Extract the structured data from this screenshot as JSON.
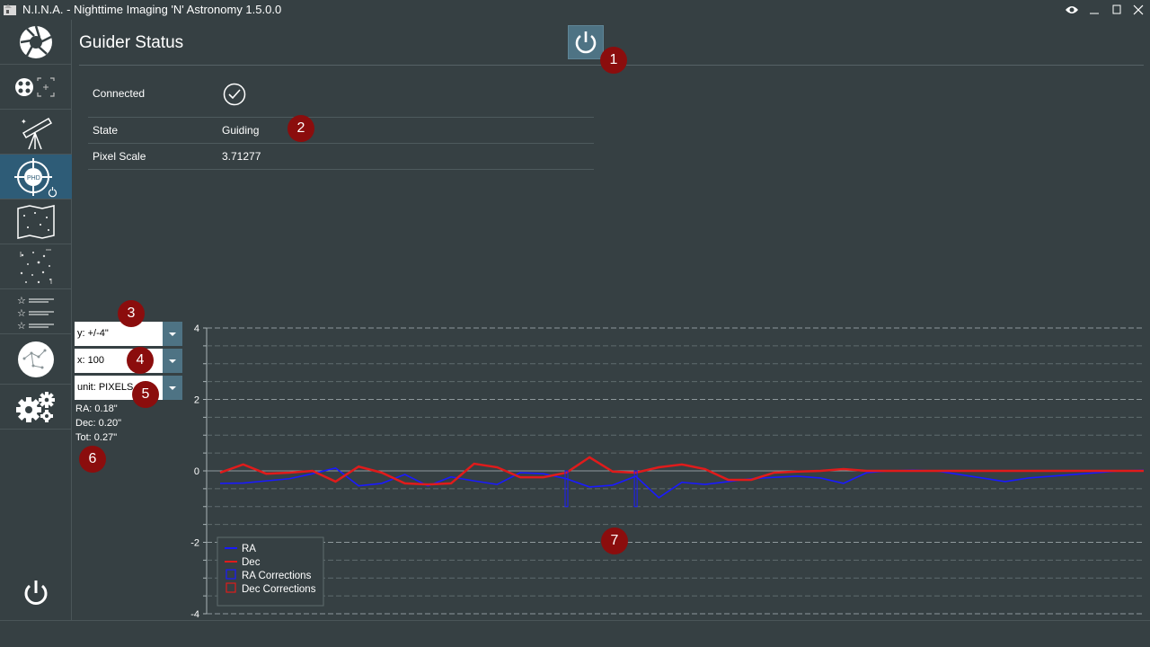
{
  "window": {
    "title": "N.I.N.A. - Nighttime Imaging 'N' Astronomy 1.5.0.0"
  },
  "sidebar": {
    "items": [
      {
        "name": "imaging"
      },
      {
        "name": "equipment-camera"
      },
      {
        "name": "telescope"
      },
      {
        "name": "guider",
        "active": true
      },
      {
        "name": "sky-atlas"
      },
      {
        "name": "framing"
      },
      {
        "name": "sequence"
      },
      {
        "name": "options-sky"
      },
      {
        "name": "settings"
      }
    ]
  },
  "header": {
    "title": "Guider Status"
  },
  "guider": {
    "connected_label": "Connected",
    "state_label": "State",
    "state_value": "Guiding",
    "pixel_scale_label": "Pixel Scale",
    "pixel_scale_value": "3.71277"
  },
  "controls": {
    "y_scale": "y: +/-4\"",
    "x_points": "x: 100",
    "unit": "unit: PIXELS"
  },
  "stats": {
    "ra": "RA: 0.18\"",
    "dec": "Dec: 0.20\"",
    "tot": "Tot: 0.27\""
  },
  "callouts": [
    "1",
    "2",
    "3",
    "4",
    "5",
    "6",
    "7"
  ],
  "colors": {
    "ra": "#1a1aff",
    "dec": "#e01b1b",
    "accent": "#4e7384",
    "callout": "#8b0d0d"
  },
  "chart_data": {
    "type": "line",
    "ylim": [
      -4,
      4
    ],
    "y_ticks": [
      "4",
      "2",
      "0",
      "-2",
      "-4"
    ],
    "grid": true,
    "legend_position": "bottom-left",
    "legend": [
      "RA",
      "Dec",
      "RA Corrections",
      "Dec Corrections"
    ],
    "x": [
      0,
      1,
      2,
      3,
      4,
      5,
      6,
      7,
      8,
      9,
      10,
      11,
      12,
      13,
      14,
      15,
      16,
      17,
      18,
      19,
      20,
      21,
      22,
      23,
      24,
      25,
      26,
      27,
      28,
      29,
      30,
      31,
      32,
      33,
      34,
      35,
      36,
      37,
      38,
      39,
      40
    ],
    "series": [
      {
        "name": "RA",
        "values": [
          -0.35,
          -0.34,
          -0.28,
          -0.22,
          -0.08,
          0.08,
          -0.42,
          -0.35,
          -0.1,
          -0.42,
          -0.17,
          -0.28,
          -0.38,
          -0.05,
          -0.08,
          -0.22,
          -0.45,
          -0.4,
          -0.15,
          -0.75,
          -0.32,
          -0.38,
          -0.3,
          -0.22,
          -0.18,
          -0.15,
          -0.2,
          -0.35,
          -0.05,
          0.0,
          0.02,
          0.0,
          -0.1,
          -0.2,
          -0.3,
          -0.2,
          -0.15,
          -0.1,
          -0.05,
          0.0,
          0.02
        ]
      },
      {
        "name": "Dec",
        "values": [
          -0.05,
          0.18,
          -0.08,
          -0.05,
          0.0,
          -0.3,
          0.12,
          -0.05,
          -0.35,
          -0.38,
          -0.35,
          0.2,
          0.1,
          -0.18,
          -0.18,
          -0.05,
          0.38,
          -0.02,
          -0.05,
          0.1,
          0.18,
          0.05,
          -0.25,
          -0.25,
          -0.05,
          -0.02,
          0.0,
          0.05,
          0.0,
          0.0,
          0.0,
          0.0,
          0.0,
          0.0,
          0.0,
          0.0,
          0.0,
          0.0,
          0.0,
          0.0,
          0.0
        ]
      },
      {
        "name": "RA Corrections",
        "bars": [
          {
            "index": 15,
            "value": -1.0
          },
          {
            "index": 18,
            "value": -1.0
          }
        ]
      }
    ]
  }
}
